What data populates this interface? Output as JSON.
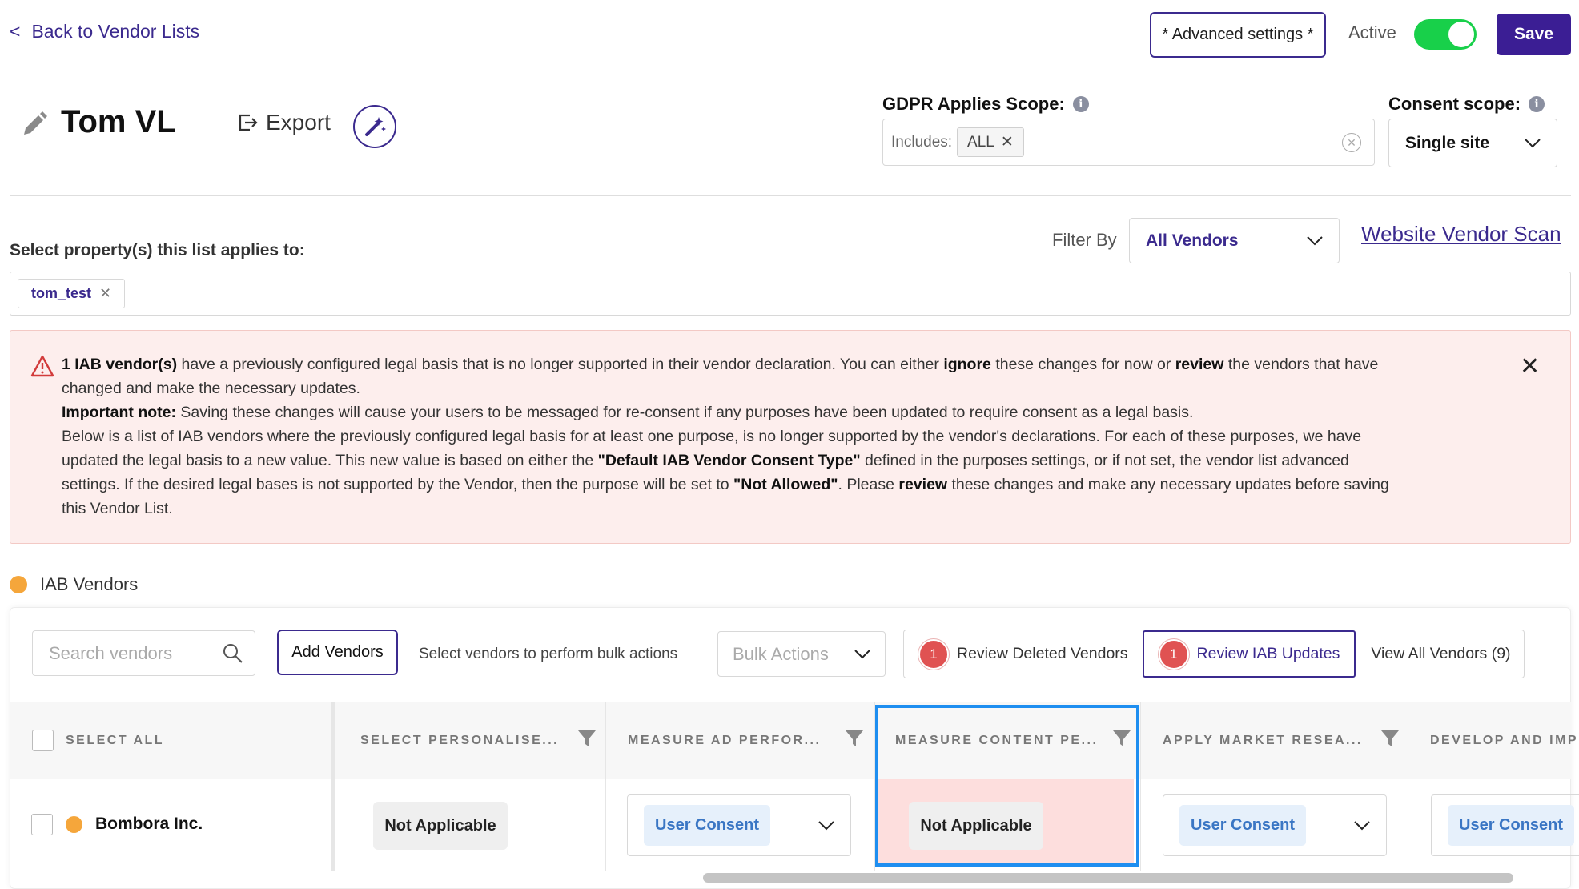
{
  "header": {
    "back_link": "Back to Vendor Lists",
    "back_chevron": "<",
    "advanced_settings": "* Advanced settings *",
    "active_label": "Active",
    "active_on": true,
    "save": "Save"
  },
  "list": {
    "title": "Tom VL",
    "export_label": "Export"
  },
  "gdpr": {
    "label": "GDPR Applies Scope:",
    "includes_label": "Includes:",
    "chip": "ALL"
  },
  "consent_scope": {
    "label": "Consent scope:",
    "value": "Single site"
  },
  "properties": {
    "label": "Select property(s) this list applies to:",
    "chips": [
      "tom_test"
    ]
  },
  "filter": {
    "label": "Filter By",
    "value": "All Vendors",
    "scan_link": "Website Vendor Scan"
  },
  "alert": {
    "p1_count": "1 IAB vendor(s)",
    "p1_a": " have a previously configured legal basis that is no longer supported in their vendor declaration. You can either ",
    "p1_ignore": "ignore",
    "p1_b": " these changes for now or ",
    "p1_review": "review",
    "p1_c": " the vendors that have changed and make the necessary updates.",
    "p2_label": "Important note:",
    "p2_text": " Saving these changes will cause your users to be messaged for re-consent if any purposes have been updated to require consent as a legal basis.",
    "p3_a": "Below is a list of IAB vendors where the previously configured legal basis for at least one purpose, is no longer supported by the vendor's declarations. For each of these purposes, we have updated the legal basis to a new value. This new value is based on either the ",
    "p3_default": "\"Default IAB Vendor Consent Type\"",
    "p3_b": " defined in the purposes settings, or if not set, the vendor list advanced settings. If the desired legal bases is not supported by the Vendor, then the purpose will be set to ",
    "p3_not_allowed": "\"Not Allowed\"",
    "p3_c": ". Please ",
    "p3_review": "review",
    "p3_d": " these changes and make any necessary updates before saving this Vendor List."
  },
  "iab_section": {
    "title": "IAB Vendors",
    "dot_color": "#f5a63b"
  },
  "toolbar": {
    "search_placeholder": "Search vendors",
    "add_vendors": "Add Vendors",
    "bulk_hint": "Select vendors to perform bulk actions",
    "bulk_actions": "Bulk Actions",
    "tabs": [
      {
        "badge": "1",
        "label": "Review Deleted Vendors"
      },
      {
        "badge": "1",
        "label": "Review IAB Updates"
      },
      {
        "label": "View All Vendors (9)"
      }
    ]
  },
  "table": {
    "columns": [
      "SELECT ALL",
      "SELECT PERSONALISE...",
      "MEASURE AD PERFOR...",
      "MEASURE CONTENT PE...",
      "APPLY MARKET RESEA...",
      "DEVELOP AND IMP"
    ],
    "rows": [
      {
        "vendor": "Bombora Inc.",
        "cells": [
          "Not Applicable",
          "User Consent",
          "Not Applicable",
          "User Consent",
          "User Consent"
        ]
      }
    ]
  },
  "colors": {
    "brand": "#3b1e94",
    "link": "#3b2a8e",
    "toggle_on": "#18d04a",
    "alert_bg": "#fdeeed",
    "highlight_cell": "#fddedd",
    "highlight_frame": "#1e8ef0",
    "badge": "#e05252"
  }
}
